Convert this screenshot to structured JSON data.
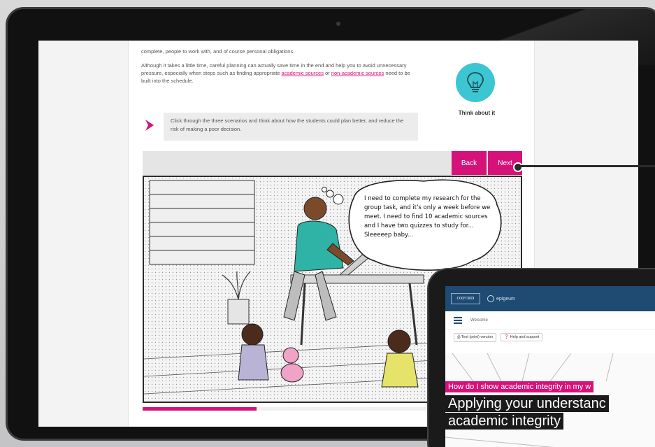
{
  "lesson": {
    "para1": "complete, people to work with, and of course personal obligations.",
    "para2_start": "Although it takes a little time, careful planning can actually save time in the end and help you to avoid unnecessary pressure, especially when steps such as finding appropriate ",
    "link1": "academic sources",
    "para2_mid": " or ",
    "link2": "non-academic sources",
    "para2_end": " need to be built into the schedule.",
    "think_label": "Think about it",
    "callout": "Click through the three scenarios and think about how the students could plan better, and reduce the risk of making a poor decision.",
    "back_label": "Back",
    "next_label": "Next",
    "progress_fraction": 0.3,
    "speech": "I need to complete my research for the group task, and it's only a week before we meet. I need to find 10 academic sources and I have two quizzes to study for... Sleeeeep baby..."
  },
  "tablet": {
    "logo": "OXFORD",
    "brand": "epigeum",
    "menu_label": "Welcome",
    "tool1": "Text (print) version",
    "tool2": "Help and support",
    "kicker": "How do I show academic integrity in my w",
    "title_line1": "Applying your understanc",
    "title_line2": "academic integrity"
  },
  "colors": {
    "accent": "#d6127a",
    "teal": "#3cc6d1",
    "navy": "#1f4a72"
  }
}
